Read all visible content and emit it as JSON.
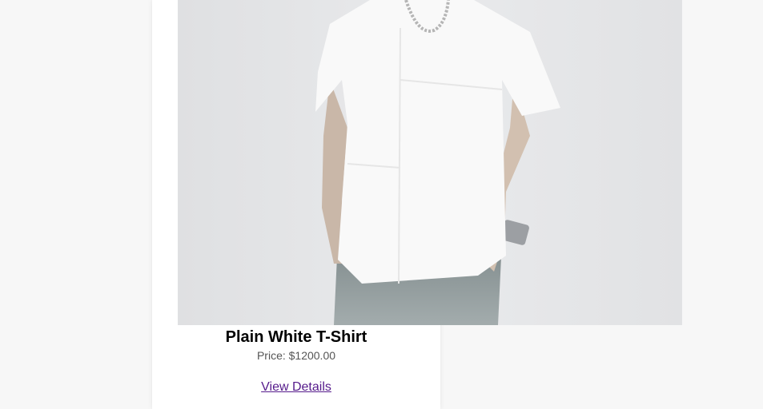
{
  "product": {
    "name": "Plain White T-Shirt",
    "price": "Price: $1200.00",
    "link_label": "View Details",
    "image_icon": "product-photo-white-tshirt"
  },
  "colors": {
    "page_background": "#f7f7f7",
    "card_background": "#ffffff",
    "link": "#551a8b",
    "price_text": "#555555"
  }
}
